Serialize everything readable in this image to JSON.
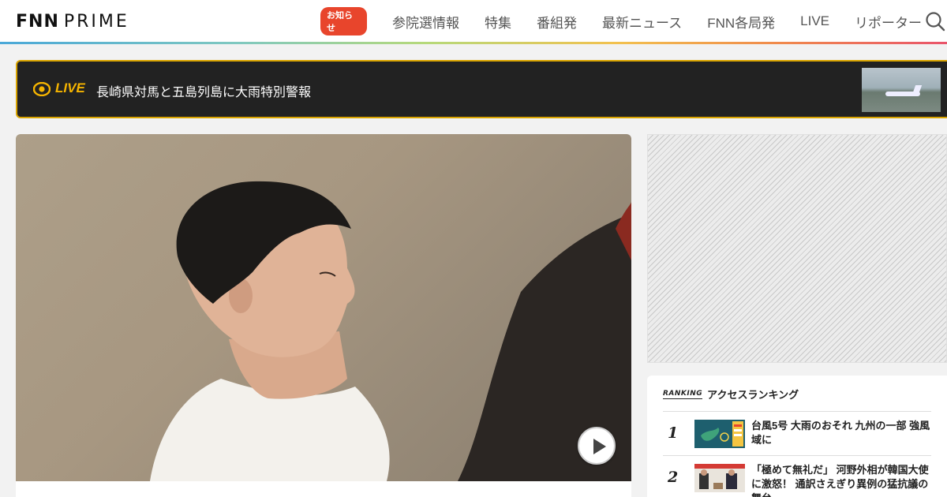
{
  "header": {
    "logo": {
      "fnn": "FNN",
      "prime": "PRIME"
    },
    "badge": "お知らせ",
    "nav": [
      "参院選情報",
      "特集",
      "番組発",
      "最新ニュース",
      "FNN各局発",
      "LIVE",
      "リポーター"
    ],
    "search_icon": "search-icon"
  },
  "live": {
    "label": "LIVE",
    "title": "長崎県対馬と五島列島に大雨特別警報"
  },
  "video": {
    "play_icon": "play-icon"
  },
  "ranking": {
    "tag": "RANKING",
    "title": "アクセスランキング",
    "items": [
      {
        "rank": "1",
        "title": "台風5号 大雨のおそれ 九州の一部 強風域に"
      },
      {
        "rank": "2",
        "title": "「極めて無礼だ」 河野外相が韓国大使に激怒！ 通訳さえぎり異例の猛抗議の舞台"
      }
    ]
  },
  "colors": {
    "accent_red": "#e8452c",
    "live_yellow": "#f5b400",
    "live_bg": "#222222"
  }
}
